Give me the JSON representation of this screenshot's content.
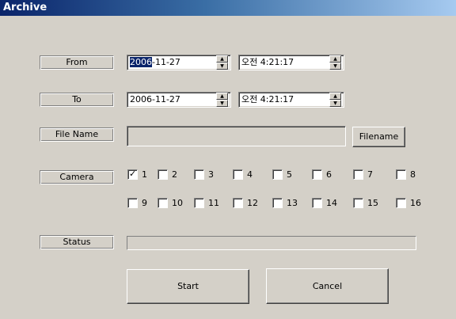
{
  "window": {
    "title": "Archive"
  },
  "labels": {
    "from": "From",
    "to": "To",
    "file_name": "File Name",
    "camera": "Camera",
    "status": "Status"
  },
  "from": {
    "date_selected": "2006",
    "date_rest": "-11-27",
    "time": "오전  4:21:17"
  },
  "to": {
    "date": "2006-11-27",
    "time": "오전  4:21:17"
  },
  "file_name_value": "",
  "buttons": {
    "filename": "Filename",
    "start": "Start",
    "cancel": "Cancel"
  },
  "cameras": [
    {
      "label": "1",
      "checked": true
    },
    {
      "label": "2",
      "checked": false
    },
    {
      "label": "3",
      "checked": false
    },
    {
      "label": "4",
      "checked": false
    },
    {
      "label": "5",
      "checked": false
    },
    {
      "label": "6",
      "checked": false
    },
    {
      "label": "7",
      "checked": false
    },
    {
      "label": "8",
      "checked": false
    },
    {
      "label": "9",
      "checked": false
    },
    {
      "label": "10",
      "checked": false
    },
    {
      "label": "11",
      "checked": false
    },
    {
      "label": "12",
      "checked": false
    },
    {
      "label": "13",
      "checked": false
    },
    {
      "label": "14",
      "checked": false
    },
    {
      "label": "15",
      "checked": false
    },
    {
      "label": "16",
      "checked": false
    }
  ],
  "status_progress": 0,
  "colors": {
    "title_start": "#0a246a",
    "title_end": "#a6caf0",
    "face": "#d4d0c8",
    "selection": "#0a246a"
  }
}
